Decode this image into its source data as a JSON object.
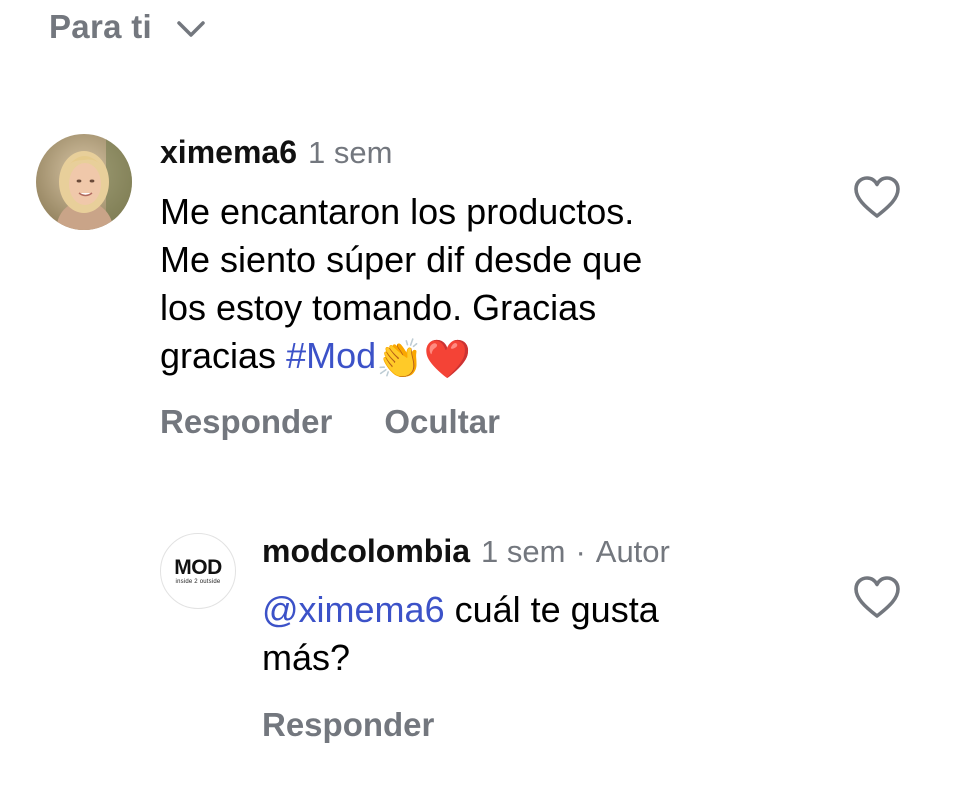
{
  "header": {
    "sort_label": "Para ti",
    "sort_icon": "chevron-down-icon"
  },
  "comments": [
    {
      "username": "ximema6",
      "time": "1 sem",
      "text_before": "Me encantaron los productos.\nMe siento súper dif desde que\nlos estoy tomando.  Gracias\ngracias ",
      "hashtag": "#Mod",
      "emojis": [
        "👏",
        "❤️"
      ],
      "actions": [
        "Responder",
        "Ocultar"
      ],
      "like_icon": "heart-icon"
    }
  ],
  "reply": {
    "username": "modcolombia",
    "time": "1 sem",
    "separator": "·",
    "author_label": "Autor",
    "avatar": {
      "logo": "MOD",
      "tagline": "inside 2 outside"
    },
    "mention": "@ximema6",
    "text": " cuál te gusta\nmás?",
    "actions": [
      "Responder"
    ],
    "like_icon": "heart-icon"
  },
  "colors": {
    "secondary_text": "#73777e",
    "link": "#3c52c8",
    "primary_text": "#000000"
  }
}
